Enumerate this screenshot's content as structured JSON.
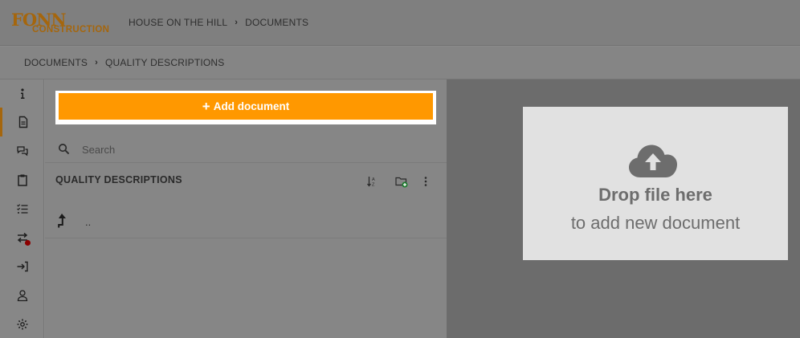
{
  "brand": {
    "logo_main": "FONN",
    "logo_sub": "CONSTRUCTION",
    "color": "#a5660d"
  },
  "top_breadcrumb": {
    "project": "HOUSE ON THE HILL",
    "section": "DOCUMENTS"
  },
  "sub_breadcrumb": {
    "root": "DOCUMENTS",
    "current": "QUALITY DESCRIPTIONS"
  },
  "rail": {
    "items": [
      {
        "icon": "info-icon"
      },
      {
        "icon": "document-icon",
        "active": true
      },
      {
        "icon": "chat-icon"
      },
      {
        "icon": "clipboard-icon"
      },
      {
        "icon": "checklist-icon"
      },
      {
        "icon": "transfer-icon",
        "notification": true
      },
      {
        "icon": "sign-in-icon"
      },
      {
        "icon": "user-icon"
      },
      {
        "icon": "settings-icon"
      }
    ]
  },
  "actions": {
    "add_document_label": "Add document",
    "add_document_color": "#ff9800"
  },
  "search": {
    "placeholder": "Search"
  },
  "folder": {
    "title": "QUALITY DESCRIPTIONS",
    "up_label": ".."
  },
  "dropzone": {
    "title": "Drop file here",
    "subtitle": "to add new document"
  }
}
